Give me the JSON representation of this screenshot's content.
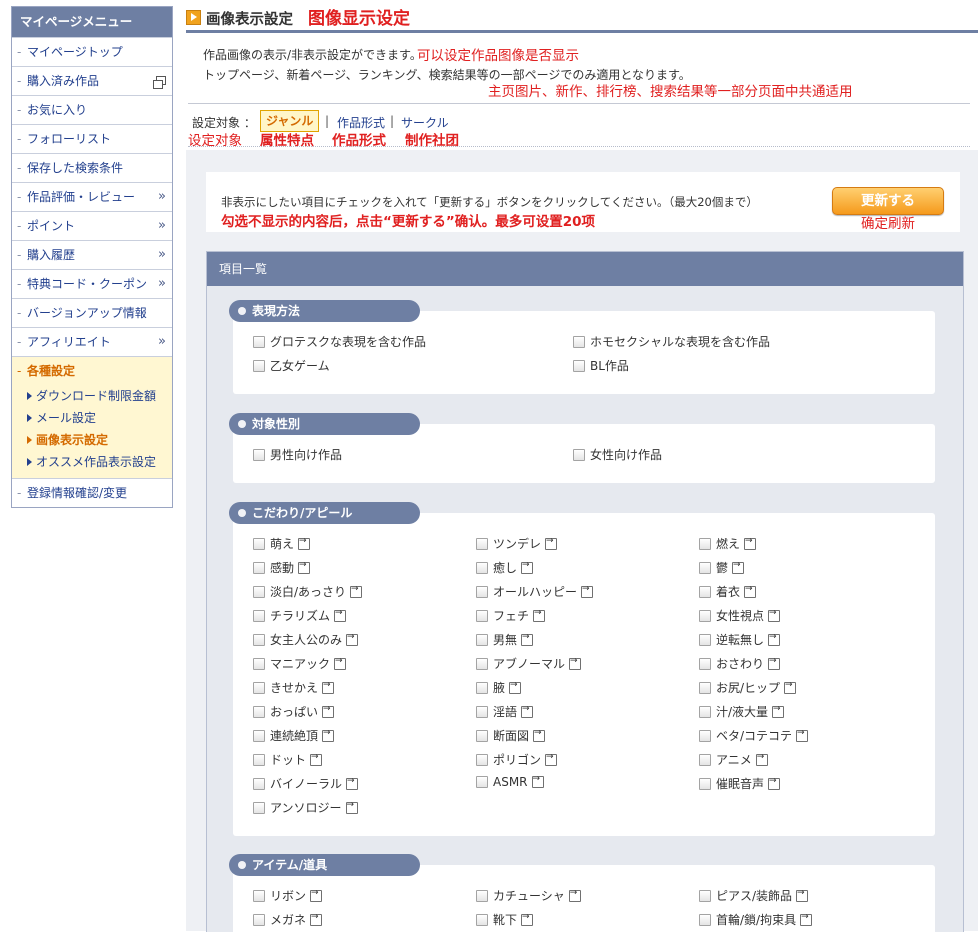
{
  "sidebar": {
    "title": "マイページメニュー",
    "items": [
      {
        "label": "マイページトップ",
        "mark": ""
      },
      {
        "label": "購入済み作品",
        "mark": "window"
      },
      {
        "label": "お気に入り",
        "mark": ""
      },
      {
        "label": "フォローリスト",
        "mark": ""
      },
      {
        "label": "保存した検索条件",
        "mark": ""
      },
      {
        "label": "作品評価・レビュー",
        "mark": "»"
      },
      {
        "label": "ポイント",
        "mark": "»"
      },
      {
        "label": "購入履歴",
        "mark": "»"
      },
      {
        "label": "特典コード・クーポン",
        "mark": "»"
      },
      {
        "label": "バージョンアップ情報",
        "mark": ""
      },
      {
        "label": "アフィリエイト",
        "mark": "»"
      }
    ],
    "group": {
      "label": "各種設定",
      "subitems": [
        "ダウンロード制限金額",
        "メール設定",
        "画像表示設定",
        "オススメ作品表示設定"
      ],
      "active_index": 2
    },
    "last_item": "登録情報確認/変更"
  },
  "header": {
    "title": "画像表示設定",
    "title_zh": "图像显示设定",
    "desc1": "作品画像の表示/非表示設定ができます。",
    "desc1_zh": "可以设定作品图像是否显示",
    "desc2": "トップページ、新着ページ、ランキング、検索結果等の一部ページでのみ適用となります。",
    "desc2_zh": "主页图片、新作、排行榜、搜索结果等一部分页面中共通适用"
  },
  "target": {
    "label": "設定対象 ：",
    "tabs": [
      "ジャンル",
      "作品形式",
      "サークル"
    ],
    "separator": "|",
    "zh_label": "设定对象",
    "zh_tabs": [
      "属性特点",
      "作品形式",
      "制作社团"
    ]
  },
  "notice": {
    "text": "非表示にしたい項目にチェックを入れて「更新する」ボタンをクリックしてください。（最大20個まで）",
    "text_zh": "勾选不显示的内容后，点击“更新する”确认。最多可设置20项",
    "button": "更新する",
    "button_zh": "确定刷新"
  },
  "list": {
    "title": "項目一覧",
    "sections": [
      {
        "title": "表現方法",
        "cols": 2,
        "items": [
          {
            "label": "グロテスクな表現を含む作品",
            "arrow": false
          },
          {
            "label": "ホモセクシャルな表現を含む作品",
            "arrow": false
          },
          {
            "label": "乙女ゲーム",
            "arrow": false
          },
          {
            "label": "BL作品",
            "arrow": false
          }
        ]
      },
      {
        "title": "対象性別",
        "cols": 2,
        "items": [
          {
            "label": "男性向け作品",
            "arrow": false
          },
          {
            "label": "女性向け作品",
            "arrow": false
          }
        ]
      },
      {
        "title": "こだわり/アピール",
        "cols": 3,
        "items": [
          {
            "label": "萌え",
            "arrow": true
          },
          {
            "label": "ツンデレ",
            "arrow": true
          },
          {
            "label": "燃え",
            "arrow": true
          },
          {
            "label": "感動",
            "arrow": true
          },
          {
            "label": "癒し",
            "arrow": true
          },
          {
            "label": "鬱",
            "arrow": true
          },
          {
            "label": "淡白/あっさり",
            "arrow": true
          },
          {
            "label": "オールハッピー",
            "arrow": true
          },
          {
            "label": "着衣",
            "arrow": true
          },
          {
            "label": "チラリズム",
            "arrow": true
          },
          {
            "label": "フェチ",
            "arrow": true
          },
          {
            "label": "女性視点",
            "arrow": true
          },
          {
            "label": "女主人公のみ",
            "arrow": true
          },
          {
            "label": "男無",
            "arrow": true
          },
          {
            "label": "逆転無し",
            "arrow": true
          },
          {
            "label": "マニアック",
            "arrow": true
          },
          {
            "label": "アブノーマル",
            "arrow": true
          },
          {
            "label": "おさわり",
            "arrow": true
          },
          {
            "label": "きせかえ",
            "arrow": true
          },
          {
            "label": "腋",
            "arrow": true
          },
          {
            "label": "お尻/ヒップ",
            "arrow": true
          },
          {
            "label": "おっぱい",
            "arrow": true
          },
          {
            "label": "淫語",
            "arrow": true
          },
          {
            "label": "汁/液大量",
            "arrow": true
          },
          {
            "label": "連続絶頂",
            "arrow": true
          },
          {
            "label": "断面図",
            "arrow": true
          },
          {
            "label": "ベタ/コテコテ",
            "arrow": true
          },
          {
            "label": "ドット",
            "arrow": true
          },
          {
            "label": "ポリゴン",
            "arrow": true
          },
          {
            "label": "アニメ",
            "arrow": true
          },
          {
            "label": "バイノーラル",
            "arrow": true
          },
          {
            "label": "ASMR",
            "arrow": true
          },
          {
            "label": "催眠音声",
            "arrow": true
          },
          {
            "label": "アンソロジー",
            "arrow": true
          }
        ]
      },
      {
        "title": "アイテム/道具",
        "cols": 3,
        "items": [
          {
            "label": "リボン",
            "arrow": true
          },
          {
            "label": "カチューシャ",
            "arrow": true
          },
          {
            "label": "ピアス/装飾品",
            "arrow": true
          },
          {
            "label": "メガネ",
            "arrow": true
          },
          {
            "label": "靴下",
            "arrow": true
          },
          {
            "label": "首輪/鎖/拘束具",
            "arrow": true
          }
        ]
      }
    ]
  }
}
